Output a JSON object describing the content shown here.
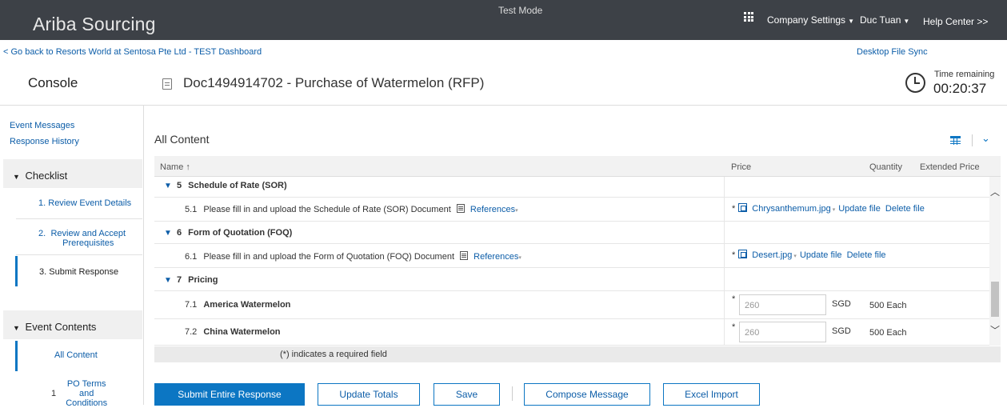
{
  "topbar": {
    "brand": "Ariba Sourcing",
    "mode": "Test Mode",
    "company_settings": "Company Settings",
    "user": "Duc Tuan",
    "help": "Help Center >>"
  },
  "subbar": {
    "back_link": "< Go back to Resorts World at Sentosa Pte Ltd - TEST Dashboard",
    "desktop_sync": "Desktop File Sync"
  },
  "header": {
    "console": "Console",
    "doc_title": "Doc1494914702 - Purchase of Watermelon (RFP)",
    "time_label": "Time remaining",
    "time_value": "00:20:37"
  },
  "sidebar": {
    "links": [
      "Event Messages",
      "Response History"
    ],
    "checklist_title": "Checklist",
    "checklist": [
      {
        "num": "1.",
        "label": "Review Event Details"
      },
      {
        "num": "2.",
        "label": "Review and Accept Prerequisites"
      },
      {
        "num": "3.",
        "label": "Submit Response"
      }
    ],
    "event_contents_title": "Event Contents",
    "event_items": [
      {
        "num": "",
        "label": "All Content"
      },
      {
        "num": "1",
        "label": "PO Terms and Conditions"
      }
    ]
  },
  "main": {
    "section_title": "All Content",
    "columns": {
      "name": "Name ↑",
      "price": "Price",
      "quantity": "Quantity",
      "extended": "Extended Price"
    },
    "rows": [
      {
        "type": "section",
        "num": "5",
        "label": "Schedule of Rate (SOR)"
      },
      {
        "type": "doc",
        "num": "5.1",
        "label": "Please fill in and upload the Schedule of Rate (SOR) Document",
        "ref": "References",
        "file": "Chrysanthemum.jpg",
        "update": "Update file",
        "delete": "Delete file"
      },
      {
        "type": "section",
        "num": "6",
        "label": "Form of Quotation (FOQ)"
      },
      {
        "type": "doc",
        "num": "6.1",
        "label": "Please fill in and upload the Form of Quotation (FOQ) Document",
        "ref": "References",
        "file": "Desert.jpg",
        "update": "Update file",
        "delete": "Delete file"
      },
      {
        "type": "section",
        "num": "7",
        "label": "Pricing"
      },
      {
        "type": "item",
        "num": "7.1",
        "label": "America Watermelon",
        "price": "260",
        "currency": "SGD",
        "qty": "500 Each"
      },
      {
        "type": "item",
        "num": "7.2",
        "label": "China Watermelon",
        "price": "260",
        "currency": "SGD",
        "qty": "500 Each"
      }
    ],
    "required_note": "(*) indicates a required field",
    "required_mark": "*",
    "section_toggle": "▼",
    "dropdown_caret": "▾"
  },
  "buttons": {
    "submit": "Submit Entire Response",
    "update_totals": "Update Totals",
    "save": "Save",
    "compose": "Compose Message",
    "excel": "Excel Import"
  },
  "colors": {
    "accent": "#0c76c3",
    "link": "#0c5da8",
    "topbar": "#3d4147"
  }
}
